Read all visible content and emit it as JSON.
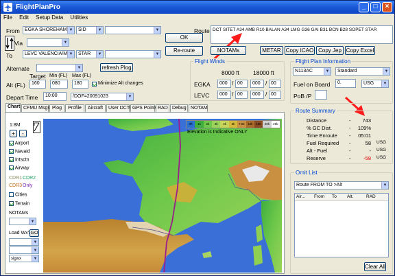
{
  "window": {
    "title": "FlightPlanPro"
  },
  "menu": {
    "items": [
      "File",
      "Edit",
      "Setup Data",
      "Utilities"
    ]
  },
  "route_form": {
    "from_label": "From",
    "from_value": "EGKA SHOREHAM",
    "sid_value": "SID",
    "via_label": "Via",
    "to_label": "To",
    "to_value": "LEVC VALENCIA/MA",
    "star_value": "STAR",
    "alternate_label": "Alternate",
    "refresh_label": "refresh Plog",
    "target_label": "Target",
    "min_label": "Min (FL)",
    "max_label": "Max (FL)",
    "alt_label": "Alt (FL)",
    "alt_target": "160",
    "alt_min": "080",
    "alt_max": "180",
    "minimize_label": "Minimize Alt changes",
    "depart_label": "Depart Time",
    "depart_value": "10:00",
    "dof_value": "/DOF=20091023",
    "ok_label": "OK",
    "reroute_label": "Re-route",
    "route_label": "Route",
    "route_text": "DCT SITET A34 AMB R10 BALAN A34 LMG G36 GAI B31 BCN B28 SOPET STAR"
  },
  "export_buttons": [
    "NOTAMs",
    "METAR",
    "Copy ICAO",
    "Copy Jep",
    "Copy Excel"
  ],
  "flight_winds": {
    "title": "Flight Winds",
    "col1": "8000 ft",
    "col2": "18000 ft",
    "rows": [
      {
        "label": "EGKA",
        "v": [
          "000",
          "00",
          "000",
          "00"
        ]
      },
      {
        "label": "LEVC",
        "v": [
          "000",
          "00",
          "000",
          "00"
        ]
      }
    ]
  },
  "flight_plan_info": {
    "title": "Flight Plan Information",
    "aircraft": "N113AC",
    "profile": "Standard",
    "fuel_label": "Fuel on Board",
    "fuel_value": "0.",
    "fuel_unit": "USG",
    "pob_label": "PoB /P"
  },
  "route_summary": {
    "title": "Route Summary",
    "rows": [
      {
        "label": "Distance",
        "value": "743",
        "unit": "",
        "color": "#000000"
      },
      {
        "label": "% GC Dist.",
        "value": "109%",
        "unit": "",
        "color": "#000000"
      },
      {
        "label": "Time Enroute",
        "value": "05:01",
        "unit": "",
        "color": "#000000"
      },
      {
        "label": "Fuel Required",
        "value": "58",
        "unit": "USG",
        "color": "#000000"
      },
      {
        "label": "Alt - Fuel",
        "value": "-",
        "unit": "USG",
        "color": "#000000"
      },
      {
        "label": "Reserve",
        "value": "-58",
        "unit": "USG",
        "color": "#e00000"
      }
    ]
  },
  "omit_list": {
    "title": "Omit List",
    "dropdown": "Route FROM TO  >Alt",
    "columns": [
      "Air...",
      "From",
      "To",
      "Alt.",
      "RAD"
    ],
    "clear_label": "Clear All"
  },
  "tabs": [
    "Chart",
    "CFMU Msgs",
    "Plog",
    "Profile",
    "Aircraft",
    "User DCTs",
    "GPS Points",
    "RAD",
    "Debug",
    "NOTAM"
  ],
  "chart_panel": {
    "scale": "1:8M",
    "zoom_in": "+",
    "zoom_out": "-",
    "layers": [
      {
        "label": "Airport",
        "checked": true
      },
      {
        "label": "Navaid",
        "checked": true
      },
      {
        "label": "Intsctn",
        "checked": true
      },
      {
        "label": "Airway",
        "checked": true
      }
    ],
    "cdr1": "CDR1",
    "cdr2": "CDR2",
    "cdr3": "CDR3",
    "only": "Only",
    "cities": "Cities",
    "terrain": "Terrain",
    "notams_label": "NOTAMs",
    "load_wx": "Load Wx?",
    "go": "GO",
    "wx_select": "sigwx",
    "elevation_note": "Elevation is Indicative ONLY",
    "legend": [
      "0ft",
      "1k",
      "2k",
      "3k",
      "4k",
      "5k",
      "7.5k",
      "10k",
      "15k",
      "20k",
      "25k"
    ]
  },
  "colors": {
    "title_bar": "#1c5ad8",
    "group_title": "#0046d5",
    "route_line": "#9b1e8c",
    "sea": "#3b6fd8"
  }
}
